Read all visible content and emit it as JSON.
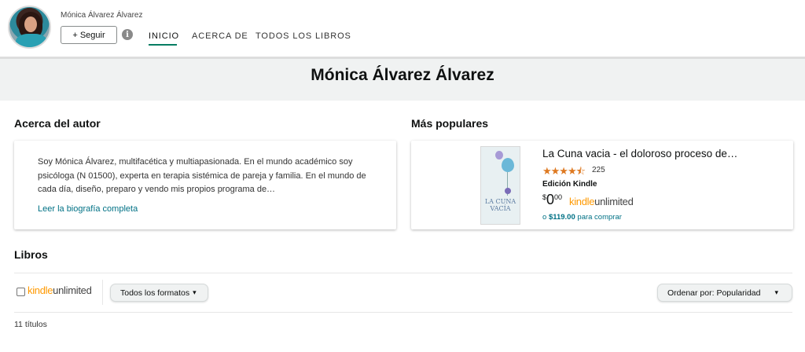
{
  "header": {
    "author_name_small": "Mónica Álvarez Álvarez",
    "follow_label": "+ Seguir",
    "info_glyph": "i",
    "nav": [
      {
        "label": "INICIO",
        "active": true
      },
      {
        "label": "ACERCA DE",
        "active": false
      },
      {
        "label": "TODOS LOS LIBROS",
        "active": false
      }
    ]
  },
  "band": {
    "title": "Mónica Álvarez Álvarez"
  },
  "about": {
    "heading": "Acerca del autor",
    "bio": "Soy Mónica Álvarez, multifacética y multiapasionada. En el mundo académico soy psicóloga (N 01500), experta en terapia sistémica de pareja y familia. En el mundo de cada día, diseño, preparo y vendo mis propios programa de…",
    "read_more": "Leer la biografía completa"
  },
  "popular": {
    "heading": "Más populares",
    "book": {
      "cover_title_line1": "LA CUNA",
      "cover_title_line2": "VACÍA",
      "title": "La Cuna vacia - el doloroso proceso de…",
      "stars": "★★★★⯪",
      "rating_value": 4.5,
      "rating_count": "225",
      "edition": "Edición Kindle",
      "price_currency": "$",
      "price_whole": "0",
      "price_fraction": "00",
      "ku_kindle": "kindle",
      "ku_unlimited": "unlimited",
      "buy_prefix": "o",
      "buy_price": "$119.00",
      "buy_suffix": "para comprar"
    }
  },
  "books": {
    "heading": "Libros",
    "ku_kindle": "kindle",
    "ku_unlimited": "unlimited",
    "formats_label": "Todos los formatos",
    "sort_label": "Ordenar por: Popularidad",
    "count": "11 títulos"
  },
  "colors": {
    "accent_teal": "#067d62",
    "link": "#007185",
    "star": "#de7921",
    "kindle_orange": "#ff9900",
    "band_bg": "#f0f2f2"
  }
}
